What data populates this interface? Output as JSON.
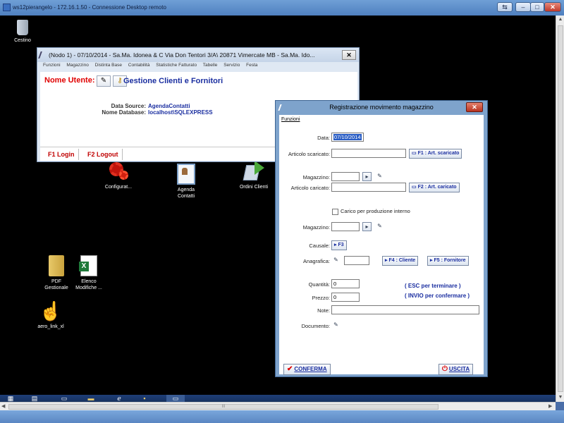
{
  "rdp": {
    "title": "ws12pierangelo - 172.16.1.50 - Connessione Desktop remoto",
    "restore_glyph": "⇆",
    "minimize_glyph": "–",
    "maximize_glyph": "□",
    "close_glyph": "✕"
  },
  "desktop": {
    "icons": {
      "recycle_bin": "Cestino",
      "config": "Configurat...",
      "agenda": "Agenda\nContatti",
      "ordini": "Ordini Clienti",
      "pdf": "PDF\nGestionale",
      "elenco": "Elenco\nModifiche ...",
      "aero": "aero_link_xl"
    }
  },
  "gestione": {
    "title": "(Nodo 1) - 07/10/2014 - Sa.Ma. Idonea & C Via Don Tentori 3/A\\ 20871 Vimercate MB - Sa.Ma. Ido...",
    "close_glyph": "✕",
    "menu": [
      "Funzioni",
      "Magazzino",
      "Distinta Base",
      "Contabilità",
      "Statistiche Fatturato",
      "Tabelle",
      "Servizio",
      "Festa"
    ],
    "user_label": "Nome Utente:",
    "heading": "Gestione Clienti e Fornitori",
    "data_source_label": "Data Source:",
    "data_source_value": "AgendaContatti",
    "db_label": "Nome Database:",
    "db_value": "localhost\\SQLEXPRESS",
    "login_btn": "F1 Login",
    "logout_btn": "F2 Logout"
  },
  "registrazione": {
    "title": "Registrazione movimento magazzino",
    "close_glyph": "✕",
    "menu": "Funzioni",
    "data_label": "Data:",
    "data_value": "07/10/2014",
    "art_scaricato_label": "Articolo scaricato:",
    "art_scaricato_value": "",
    "f1_btn": "F1 : Art. scaricato",
    "magazzino_label": "Magazzino:",
    "magazzino_value": "",
    "art_caricato_label": "Articolo caricato:",
    "art_caricato_value": "",
    "f2_btn": "F2 : Art. caricato",
    "carico_label": "Carico per produzione interno",
    "carico_checked": false,
    "magazzino2_label": "Magazzino:",
    "magazzino2_value": "",
    "causale_label": "Causale:",
    "f3_btn": "F3",
    "anagrafica_label": "Anagrafica:",
    "anagrafica_value": "",
    "f4_btn": "F4 : Cliente",
    "f5_btn": "F5 : Fornitore",
    "quantita_label": "Quantità:",
    "quantita_value": "0",
    "prezzo_label": "Prezzo:",
    "prezzo_value": "0",
    "note_label": "Note:",
    "note_value": "",
    "documento_label": "Documento:",
    "esc_hint": "( ESC per terminare )",
    "invio_hint": "( INVIO per confermare )",
    "conferma_btn": "CONFERMA",
    "uscita_btn": "USCITA"
  },
  "hscroll_glyph": "III",
  "colors": {
    "rdp_frame": "#4a6ea8",
    "dialog_border": "#7ea3cc",
    "accent_blue": "#1a2ea0",
    "accent_red": "#e00000"
  }
}
